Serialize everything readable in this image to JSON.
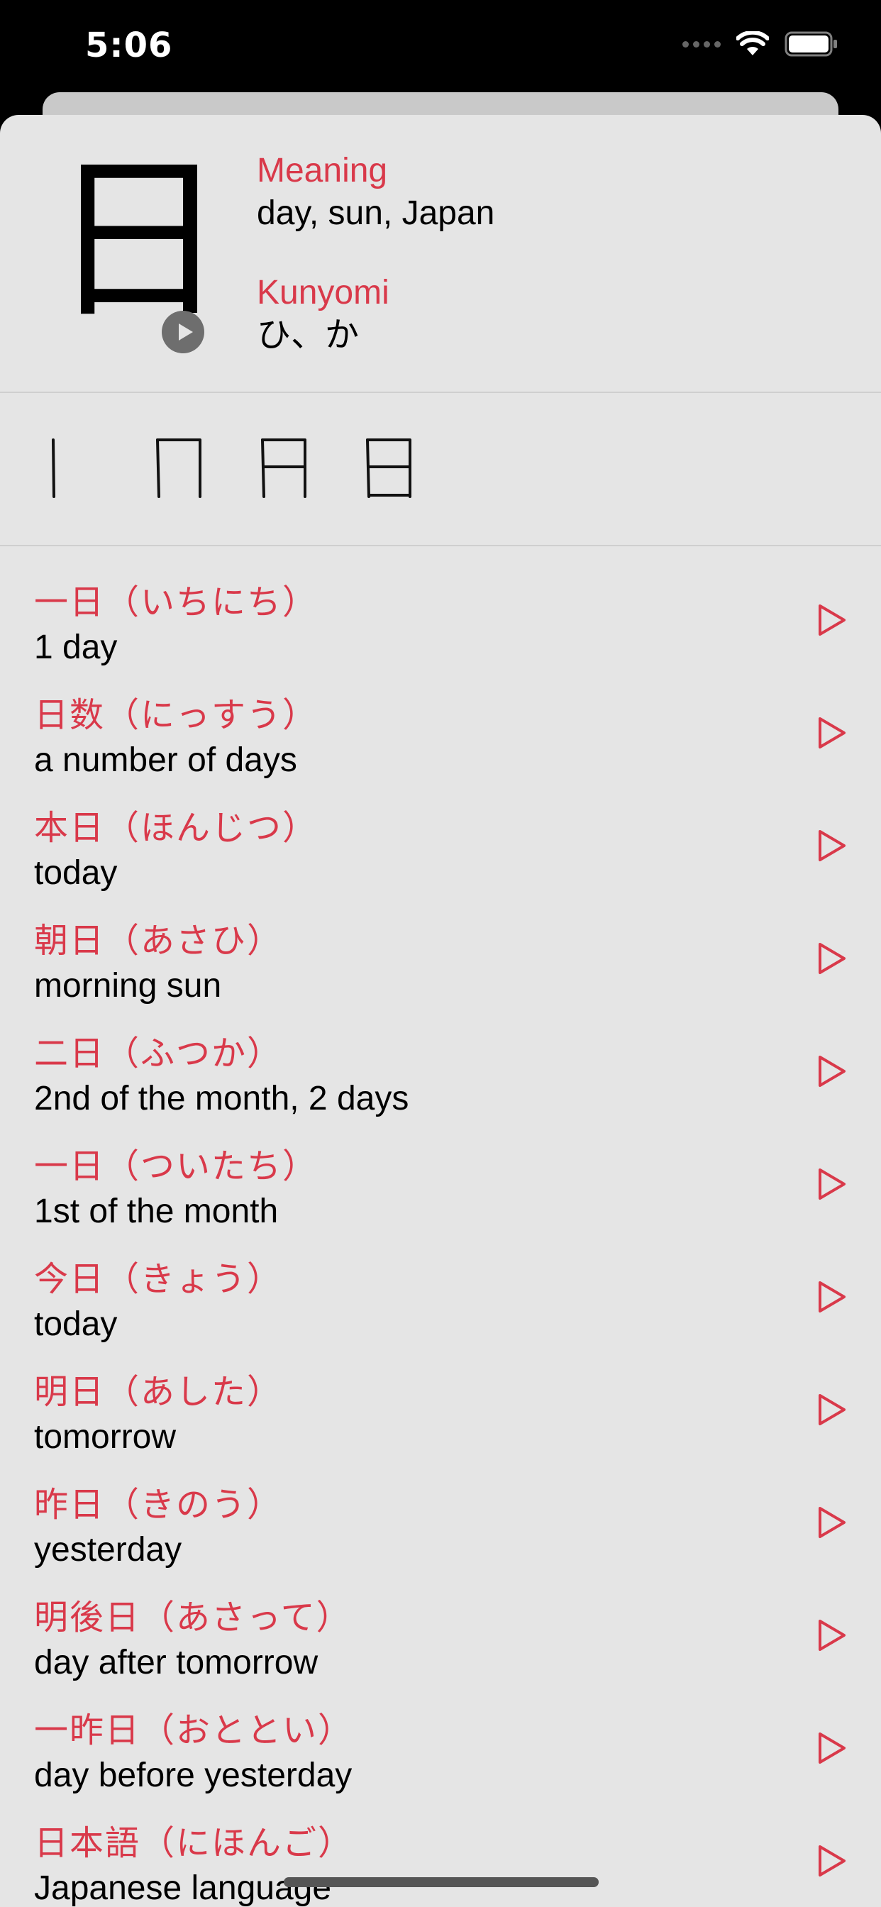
{
  "status_bar": {
    "time": "5:06"
  },
  "kanji": {
    "character": "日",
    "meaning_label": "Meaning",
    "meaning": "day, sun, Japan",
    "kunyomi_label": "Kunyomi",
    "kunyomi": "ひ、か"
  },
  "colors": {
    "accent": "#d9394a",
    "sheet_bg": "#e5e5e5"
  },
  "vocab": [
    {
      "jp": "一日（いちにち）",
      "en": "1 day"
    },
    {
      "jp": "日数（にっすう）",
      "en": "a number of days"
    },
    {
      "jp": "本日（ほんじつ）",
      "en": "today"
    },
    {
      "jp": "朝日（あさひ）",
      "en": "morning sun"
    },
    {
      "jp": "二日（ふつか）",
      "en": "2nd of the month, 2 days"
    },
    {
      "jp": "一日（ついたち）",
      "en": "1st of the month"
    },
    {
      "jp": "今日（きょう）",
      "en": "today"
    },
    {
      "jp": "明日（あした）",
      "en": "tomorrow"
    },
    {
      "jp": "昨日（きのう）",
      "en": "yesterday"
    },
    {
      "jp": "明後日（あさって）",
      "en": "day after tomorrow"
    },
    {
      "jp": "一昨日（おととい）",
      "en": "day before yesterday"
    },
    {
      "jp": "日本語（にほんご）",
      "en": "Japanese language"
    }
  ]
}
